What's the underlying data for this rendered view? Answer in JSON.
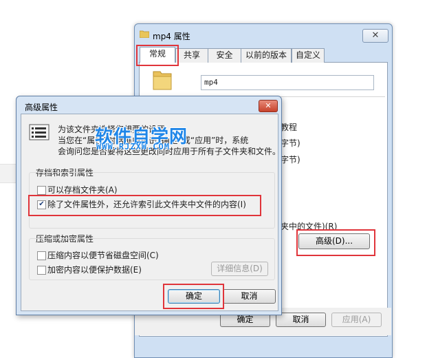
{
  "props_window": {
    "title": "mp4 属性",
    "close_glyph": "✕",
    "tabs": [
      "常规",
      "共享",
      "安全",
      "以前的版本",
      "自定义"
    ],
    "folder_name": "mp4",
    "fragments": {
      "f1": "教程",
      "f2": "字节)",
      "f3": "字节)",
      "f4": "夹中的文件)(R)"
    },
    "advanced_button": "高级(D)...",
    "ok": "确定",
    "cancel": "取消",
    "apply": "应用(A)"
  },
  "advanced_dialog": {
    "title": "高级属性",
    "close_glyph": "✕",
    "desc_line1": "为该文件夹选择您想要的设置。",
    "desc_line2": "当您在“属性”对话框中单击“确定”或“应用”时，系统",
    "desc_line3": "会询问您是否要将这些更改同时应用于所有子文件夹和文件。",
    "group_archive": {
      "title": "存档和索引属性",
      "items": [
        {
          "label": "可以存档文件夹(A)",
          "checked": false
        },
        {
          "label": "除了文件属性外，还允许索引此文件夹中文件的内容(I)",
          "checked": true
        }
      ]
    },
    "group_compress": {
      "title": "压缩或加密属性",
      "items": [
        {
          "label": "压缩内容以便节省磁盘空间(C)",
          "checked": false
        },
        {
          "label": "加密内容以便保护数据(E)",
          "checked": false
        }
      ],
      "details_button": "详细信息(D)"
    },
    "ok": "确定",
    "cancel": "取消"
  },
  "watermark": {
    "text": "软件自学网",
    "url": "WWW.RJZXW.COM"
  },
  "colors": {
    "highlight_red": "#e0343a",
    "window_frame": "#cfe0f3",
    "watermark_blue": "#1f86e8"
  }
}
